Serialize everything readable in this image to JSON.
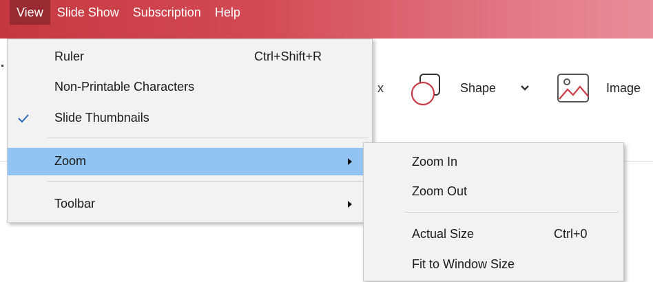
{
  "menubar": {
    "items": [
      {
        "label": "View",
        "active": true
      },
      {
        "label": "Slide Show",
        "active": false
      },
      {
        "label": "Subscription",
        "active": false
      },
      {
        "label": "Help",
        "active": false
      }
    ],
    "colors": {
      "bar": "#d34a55",
      "active": "#9a2a31"
    }
  },
  "ribbon": {
    "partial_text": "x",
    "shape_label": "Shape",
    "image_label": "Image",
    "icons": [
      "shape-icon",
      "chevron-down-icon",
      "image-icon"
    ]
  },
  "view_menu": {
    "items": [
      {
        "label": "Ruler",
        "shortcut": "Ctrl+Shift+R",
        "checked": false
      },
      {
        "label": "Non-Printable Characters",
        "shortcut": "",
        "checked": false
      },
      {
        "label": "Slide Thumbnails",
        "shortcut": "",
        "checked": true
      },
      {
        "label": "Zoom",
        "has_submenu": true,
        "highlighted": true
      },
      {
        "label": "Toolbar",
        "has_submenu": true
      }
    ]
  },
  "zoom_submenu": {
    "items": [
      {
        "label": "Zoom In",
        "shortcut": ""
      },
      {
        "label": "Zoom Out",
        "shortcut": ""
      },
      {
        "label": "Actual Size",
        "shortcut": "Ctrl+0"
      },
      {
        "label": "Fit to Window Size",
        "shortcut": ""
      }
    ]
  },
  "colors": {
    "highlight": "#91c4f2",
    "check": "#2a6bc2",
    "menu_bg": "#f2f2f2",
    "icon_red": "#cc3b45"
  }
}
